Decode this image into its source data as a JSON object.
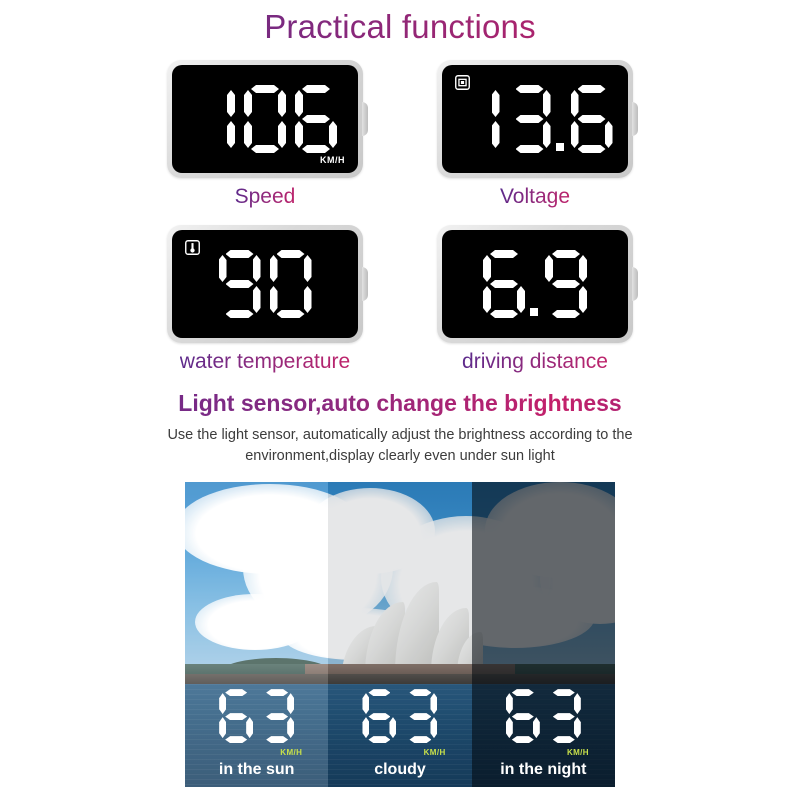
{
  "page": {
    "title": "Practical functions",
    "title_gradient_from": "#5b2a8c",
    "title_gradient_to": "#c51f62",
    "background": "#ffffff"
  },
  "devices": [
    {
      "id": "speed",
      "value": "106",
      "digits": [
        "1",
        "0",
        "6"
      ],
      "unit_label": "KM/H",
      "glyph": "none",
      "caption": "Speed"
    },
    {
      "id": "voltage",
      "value": "13.6",
      "digits": [
        "1",
        "3",
        ".",
        "6"
      ],
      "unit_label": "",
      "glyph": "battery-icon",
      "caption": "Voltage"
    },
    {
      "id": "water-temperature",
      "value": "90",
      "digits": [
        "9",
        "0"
      ],
      "unit_label": "",
      "glyph": "thermometer-icon",
      "caption": "water temperature"
    },
    {
      "id": "driving-distance",
      "value": "6.9",
      "digits": [
        "6",
        ".",
        "9"
      ],
      "unit_label": "",
      "glyph": "none",
      "caption": "driving distance"
    }
  ],
  "light_sensor": {
    "heading": "Light sensor,auto change the brightness",
    "description": "Use the light sensor, automatically adjust the brightness according to the environment,display clearly even under sun light"
  },
  "comparison": {
    "unit_label": "KM/H",
    "unit_color": "#c8e04a",
    "panes": [
      {
        "id": "sun",
        "label": "in the sun",
        "value": "63",
        "digits": [
          "6",
          "3"
        ]
      },
      {
        "id": "cloudy",
        "label": "cloudy",
        "value": "63",
        "digits": [
          "6",
          "3"
        ]
      },
      {
        "id": "night",
        "label": "in the night",
        "value": "63",
        "digits": [
          "6",
          "3"
        ]
      }
    ]
  }
}
